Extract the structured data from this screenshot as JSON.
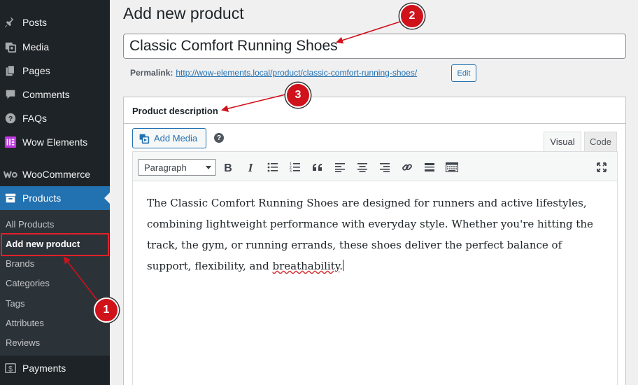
{
  "sidebar": {
    "items": [
      {
        "label": "Posts",
        "icon": "pin-icon"
      },
      {
        "label": "Media",
        "icon": "media-icon"
      },
      {
        "label": "Pages",
        "icon": "pages-icon"
      },
      {
        "label": "Comments",
        "icon": "comment-icon"
      },
      {
        "label": "FAQs",
        "icon": "question-icon"
      },
      {
        "label": "Wow Elements",
        "icon": "wow-elements-icon"
      },
      {
        "label": "WooCommerce",
        "icon": "woocommerce-icon"
      },
      {
        "label": "Products",
        "icon": "archive-icon"
      },
      {
        "label": "Payments",
        "icon": "dollar-icon"
      }
    ],
    "submenu": [
      "All Products",
      "Add new product",
      "Brands",
      "Categories",
      "Tags",
      "Attributes",
      "Reviews"
    ],
    "current_submenu": "Add new product"
  },
  "page": {
    "title": "Add new product",
    "product_title": "Classic Comfort Running Shoes",
    "permalink_label": "Permalink:",
    "permalink_base": "http://wow-elements.local/product/",
    "permalink_slug": "classic-comfort-running-shoes",
    "permalink_end": "/",
    "edit_label": "Edit"
  },
  "description": {
    "box_title": "Product description",
    "add_media_label": "Add Media",
    "help": "?",
    "tab_visual": "Visual",
    "tab_code": "Code",
    "format_selected": "Paragraph",
    "toolbar_icons": [
      "bold-icon",
      "italic-icon",
      "bulleted-list-icon",
      "numbered-list-icon",
      "blockquote-icon",
      "align-left-icon",
      "align-center-icon",
      "align-right-icon",
      "link-icon",
      "read-more-icon",
      "toolbar-toggle-icon",
      "fullscreen-icon"
    ],
    "content_main": "The Classic Comfort Running Shoes are designed for runners and active lifestyles, combining lightweight performance with everyday style. Whether you're hitting the track, the gym, or running errands, these shoes deliver the perfect balance of support, flexibility, and ",
    "content_misspelled": "breathability",
    "content_end": "."
  },
  "annotations": {
    "badge1": "1",
    "badge2": "2",
    "badge3": "3",
    "color": "#d0121b"
  }
}
